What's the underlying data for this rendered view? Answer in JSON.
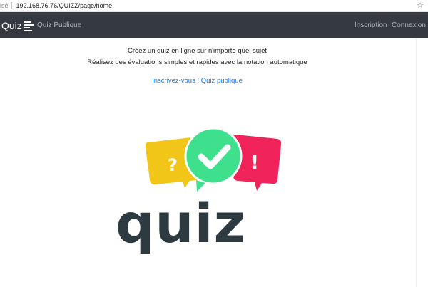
{
  "browser": {
    "security_text": "isé",
    "url": "192.168.76.76/QUIZZ/page/home",
    "star_glyph": "☆"
  },
  "navbar": {
    "brand": "Quiz",
    "public_link": "Quiz Publique",
    "inscription": "Inscription",
    "connexion": "Connexion",
    "background": "#343a40"
  },
  "intro": {
    "line1": "Créez un quiz en ligne sur n'importe quel sujet",
    "line2": "Réalisez des évaluations simples et rapides avec la notation automatique"
  },
  "links": {
    "inscrivez": "Inscrivez-vous !",
    "quiz_publique": "Quiz publique"
  },
  "logo": {
    "word": "quiz",
    "question_mark": "?",
    "exclamation": "!",
    "colors": {
      "yellow": "#f2c618",
      "green": "#3ee08e",
      "pink": "#f0245a",
      "text": "#2d3a3f"
    }
  }
}
